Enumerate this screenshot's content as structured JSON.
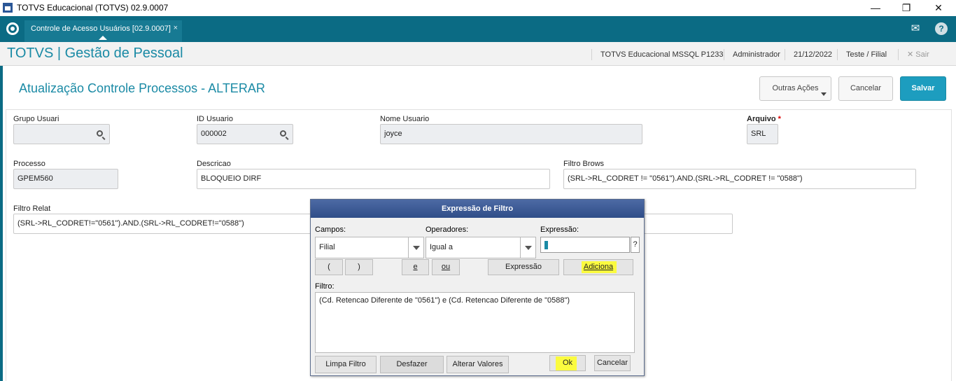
{
  "window": {
    "title": "TOTVS Educacional (TOTVS) 02.9.0007",
    "minimize": "—",
    "restore": "❐",
    "close": "✕"
  },
  "tabbar": {
    "tab_label": "Controle de Acesso Usuários [02.9.0007]",
    "tab_close": "×",
    "help": "?",
    "mail": "✉"
  },
  "header": {
    "brand": "TOTVS | Gestão de Pessoal",
    "environment": "TOTVS Educacional MSSQL P1233",
    "user": "Administrador",
    "date": "21/12/2022",
    "branch": "Teste / Filial",
    "exit": "✕  Sair"
  },
  "page": {
    "title": "Atualização Controle Processos - ALTERAR",
    "actions": {
      "outras": "Outras Ações",
      "cancelar": "Cancelar",
      "salvar": "Salvar"
    }
  },
  "form": {
    "grupo_usuari": {
      "label": "Grupo Usuari",
      "value": ""
    },
    "id_usuario": {
      "label": "ID Usuario",
      "value": "000002"
    },
    "nome_usuario": {
      "label": "Nome Usuario",
      "value": "joyce"
    },
    "arquivo": {
      "label": "Arquivo",
      "required": "*",
      "value": "SRL"
    },
    "processo": {
      "label": "Processo",
      "value": "GPEM560"
    },
    "descricao": {
      "label": "Descricao",
      "value": "BLOQUEIO DIRF"
    },
    "filtro_brows": {
      "label": "Filtro Brows",
      "value": "(SRL->RL_CODRET != \"0561\").AND.(SRL->RL_CODRET != \"0588\")"
    },
    "filtro_relat": {
      "label": "Filtro Relat",
      "value": "(SRL->RL_CODRET!=\"0561\").AND.(SRL->RL_CODRET!=\"0588\")"
    }
  },
  "dialog": {
    "title": "Expressão de Filtro",
    "campos_label": "Campos:",
    "campos_value": "Filial",
    "operadores_label": "Operadores:",
    "operadores_value": "Igual a",
    "expressao_label": "Expressão:",
    "expressao_value": "",
    "help": "?",
    "btn_open_paren": "(",
    "btn_close_paren": ")",
    "btn_e": "e",
    "btn_ou": "ou",
    "btn_expressao": "Expressão",
    "btn_adiciona": "Adiciona",
    "filtro_label": "Filtro:",
    "filtro_value": "(Cd. Retencao Diferente de \"0561\") e (Cd. Retencao Diferente de \"0588\")",
    "btn_limpa": "Limpa Filtro",
    "btn_desfazer": "Desfazer",
    "btn_alterar": "Alterar Valores",
    "btn_ok": "Ok",
    "btn_cancelar": "Cancelar",
    "highlight_color": "#fbfb3f"
  }
}
